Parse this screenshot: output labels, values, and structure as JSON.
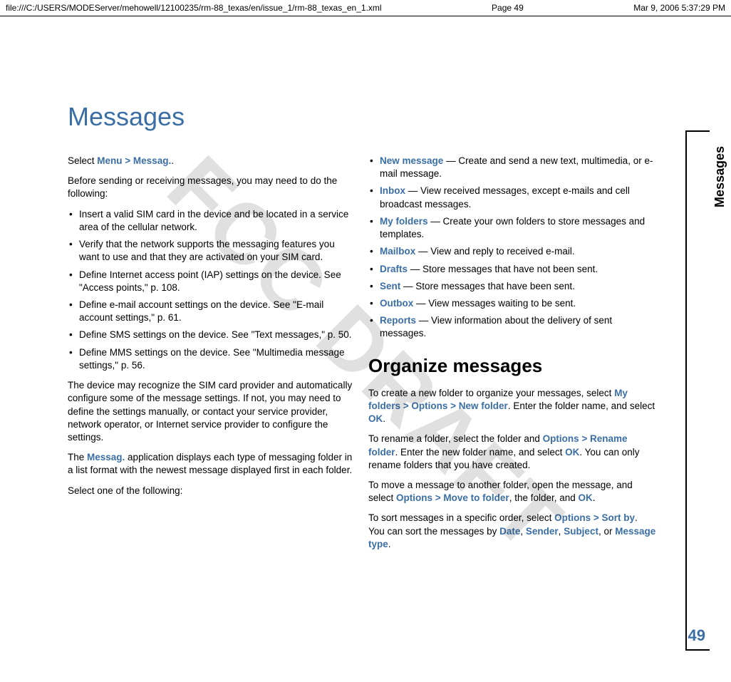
{
  "header": {
    "path": "file:///C:/USERS/MODEServer/mehowell/12100235/rm-88_texas/en/issue_1/rm-88_texas_en_1.xml",
    "page": "Page 49",
    "date": "Mar 9, 2006 5:37:29 PM"
  },
  "watermark": "FCC DRAFT",
  "side_label": "Messages",
  "page_number": "49",
  "title": "Messages",
  "left": {
    "p1_a": "Select ",
    "p1_menu": "Menu",
    "p1_gt": " > ",
    "p1_messag": "Messag.",
    "p1_b": ".",
    "p2": "Before sending or receiving messages, you may need to do the following:",
    "bullets": [
      "Insert a valid SIM card in the device and be located in a service area of the cellular network.",
      "Verify that the network supports the messaging features you want to use and that they are activated on your SIM card.",
      "Define Internet access point (IAP) settings on the device. See \"Access points,\" p. 108.",
      "Define e-mail account settings on the device. See \"E-mail account settings,\" p. 61.",
      "Define SMS settings on the device. See \"Text messages,\" p. 50.",
      "Define MMS settings on the device. See \"Multimedia message settings,\" p. 56."
    ],
    "p3": "The device may recognize the SIM card provider and automatically configure some of the message settings. If not, you may need to define the settings manually, or contact your service provider, network operator, or Internet service provider to configure the settings.",
    "p4_a": "The ",
    "p4_kw": "Messag.",
    "p4_b": " application displays each type of messaging folder in a list format with the newest message displayed first in each folder.",
    "p5": "Select one of the following:"
  },
  "right": {
    "options": [
      {
        "kw": "New message",
        "rest": " — Create and send a new text, multimedia, or e-mail message."
      },
      {
        "kw": "Inbox",
        "rest": " — View received messages, except e-mails and cell broadcast messages."
      },
      {
        "kw": "My folders",
        "rest": " — Create your own folders to store messages and templates."
      },
      {
        "kw": "Mailbox",
        "rest": " — View and reply to received e-mail."
      },
      {
        "kw": "Drafts",
        "rest": " — Store messages that have not been sent."
      },
      {
        "kw": "Sent",
        "rest": " — Store messages that have been sent."
      },
      {
        "kw": "Outbox",
        "rest": " — View messages waiting to be sent."
      },
      {
        "kw": "Reports",
        "rest": " — View information about the delivery of sent messages."
      }
    ],
    "section": "Organize messages",
    "org1_a": "To create a new folder to organize your messages, select ",
    "org1_k1": "My folders",
    "gt": " > ",
    "org1_k2": "Options",
    "org1_k3": "New folder",
    "org1_b": ". Enter the folder name, and select ",
    "org1_ok": "OK",
    "period": ".",
    "org2_a": "To rename a folder, select the folder and ",
    "org2_k1": "Options",
    "org2_k2": "Rename folder",
    "org2_b": ". Enter the new folder name, and select ",
    "org2_ok": "OK",
    "org2_c": ". You can only rename folders that you have created.",
    "org3_a": "To move a message to another folder, open the message, and select ",
    "org3_k1": "Options",
    "org3_k2": "Move to folder",
    "org3_b": ", the folder, and ",
    "org3_ok": "OK",
    "org4_a": "To sort messages in a specific order, select ",
    "org4_k1": "Options",
    "org4_k2": "Sort by",
    "org4_b": ". You can sort the messages by ",
    "org4_date": "Date",
    "comma": ", ",
    "org4_sender": "Sender",
    "org4_subject": "Subject",
    "org4_or": ", or ",
    "org4_mtype": "Message type"
  }
}
